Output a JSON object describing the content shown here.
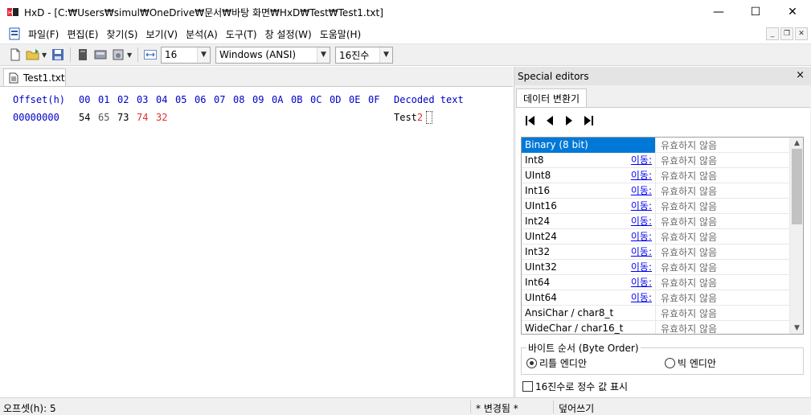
{
  "window": {
    "app_name": "HxD",
    "title": "HxD - [C:₩Users₩simul₩OneDrive₩문서₩바탕 화면₩HxD₩Test₩Test1.txt]",
    "minimize": "—",
    "maximize": "☐",
    "close": "✕"
  },
  "menu": {
    "items": [
      "파일(F)",
      "편집(E)",
      "찾기(S)",
      "보기(V)",
      "분석(A)",
      "도구(T)",
      "창 설정(W)",
      "도움말(H)"
    ],
    "mdi_minimize": "_",
    "mdi_restore": "❐",
    "mdi_close": "✕"
  },
  "toolbar": {
    "bytes_per_row": "16",
    "charset": "Windows (ANSI)",
    "offset_base": "16진수"
  },
  "document": {
    "tab_label": "Test1.txt"
  },
  "hex": {
    "offset_header": "Offset(h)",
    "columns": [
      "00",
      "01",
      "02",
      "03",
      "04",
      "05",
      "06",
      "07",
      "08",
      "09",
      "0A",
      "0B",
      "0C",
      "0D",
      "0E",
      "0F"
    ],
    "decoded_header": "Decoded text",
    "rows": [
      {
        "offset": "00000000",
        "bytes": [
          "54",
          "65",
          "73",
          "74",
          "32"
        ],
        "decoded_plain": "Test",
        "decoded_modified": "2"
      }
    ]
  },
  "colors": {
    "header_blue": "#0000c8",
    "modified_red": "#e03030",
    "selection_blue": "#0078d7",
    "link_blue": "#0000ee"
  },
  "special_editors": {
    "panel_title": "Special editors",
    "close": "×",
    "tab_label": "데이터 변환기",
    "goto_label": "이동:",
    "rows": [
      {
        "name": "Binary (8 bit)",
        "goto": "",
        "value": "유효하지 않음"
      },
      {
        "name": "Int8",
        "goto": "이동:",
        "value": "유효하지 않음"
      },
      {
        "name": "UInt8",
        "goto": "이동:",
        "value": "유효하지 않음"
      },
      {
        "name": "Int16",
        "goto": "이동:",
        "value": "유효하지 않음"
      },
      {
        "name": "UInt16",
        "goto": "이동:",
        "value": "유효하지 않음"
      },
      {
        "name": "Int24",
        "goto": "이동:",
        "value": "유효하지 않음"
      },
      {
        "name": "UInt24",
        "goto": "이동:",
        "value": "유효하지 않음"
      },
      {
        "name": "Int32",
        "goto": "이동:",
        "value": "유효하지 않음"
      },
      {
        "name": "UInt32",
        "goto": "이동:",
        "value": "유효하지 않음"
      },
      {
        "name": "Int64",
        "goto": "이동:",
        "value": "유효하지 않음"
      },
      {
        "name": "UInt64",
        "goto": "이동:",
        "value": "유효하지 않음"
      },
      {
        "name": "AnsiChar / char8_t",
        "goto": "",
        "value": "유효하지 않음"
      },
      {
        "name": "WideChar / char16_t",
        "goto": "",
        "value": "유효하지 않음"
      }
    ],
    "byte_order_label": "바이트 순서 (Byte Order)",
    "little_endian": "리틀 엔디안",
    "big_endian": "빅 엔디안",
    "hex_integers_label": "16진수로 정수 값 표시"
  },
  "status": {
    "offset": "오프셋(h): 5",
    "modified": "* 변경됨 *",
    "mode": "덮어쓰기"
  }
}
